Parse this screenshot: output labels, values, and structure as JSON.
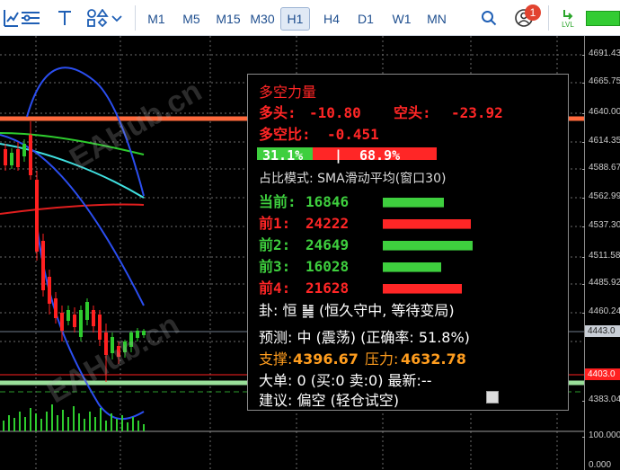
{
  "toolbar": {
    "badge": "1",
    "timeframes": [
      "M1",
      "M5",
      "M15",
      "M30",
      "H1",
      "H4",
      "D1",
      "W1",
      "MN"
    ],
    "active_timeframe": "H1",
    "algo_label": "LVL"
  },
  "price_axis": {
    "labels": [
      "4691.43",
      "4665.75",
      "4640.00",
      "4614.35",
      "4588.67",
      "4562.99",
      "4537.30",
      "4511.58",
      "4485.92",
      "4460.24",
      "4383.04",
      "100.000",
      "0.000"
    ],
    "current_price_tag": "4443.0",
    "red_price_tag": "4403.0"
  },
  "watermark": "EAHub.cn",
  "panel": {
    "title": "多空力量",
    "long_label": "多头:",
    "long_value": "-10.80",
    "short_label": "空头:",
    "short_value": "-23.92",
    "ratio_label": "多空比:",
    "ratio_value": "-0.451",
    "pct_long": "31.1%",
    "pct_sep": "|",
    "pct_short": "68.9%",
    "pct_long_fraction": 0.311,
    "mode": "占比模式: SMA滑动平均(窗口30)",
    "rows": [
      {
        "label": "当前:",
        "value": "16846",
        "color": "#3ecf3e",
        "level": 0.68
      },
      {
        "label": "前1:",
        "value": "24222",
        "color": "#ff2626",
        "level": 0.98
      },
      {
        "label": "前2:",
        "value": "24649",
        "color": "#3ecf3e",
        "level": 1.0
      },
      {
        "label": "前3:",
        "value": "16028",
        "color": "#3ecf3e",
        "level": 0.65
      },
      {
        "label": "前4:",
        "value": "21628",
        "color": "#ff2626",
        "level": 0.88
      }
    ],
    "gua": "卦: 恒 ䷟ (恒久守中, 等待变局)",
    "forecast": "预测: 中 (震荡) (正确率: 51.8%)",
    "support_label": "支撑:",
    "support_value": "4396.67",
    "pressure_label": "压力:",
    "pressure_value": "4632.78",
    "big_order": "大单: 0 (买:0 卖:0) 最新:--",
    "advice": "建议: 偏空 (轻仓试空)"
  },
  "colors": {
    "green": "#3ecf3e",
    "red": "#ff2626",
    "orange": "#ff9d1e",
    "white": "#ffffff"
  }
}
